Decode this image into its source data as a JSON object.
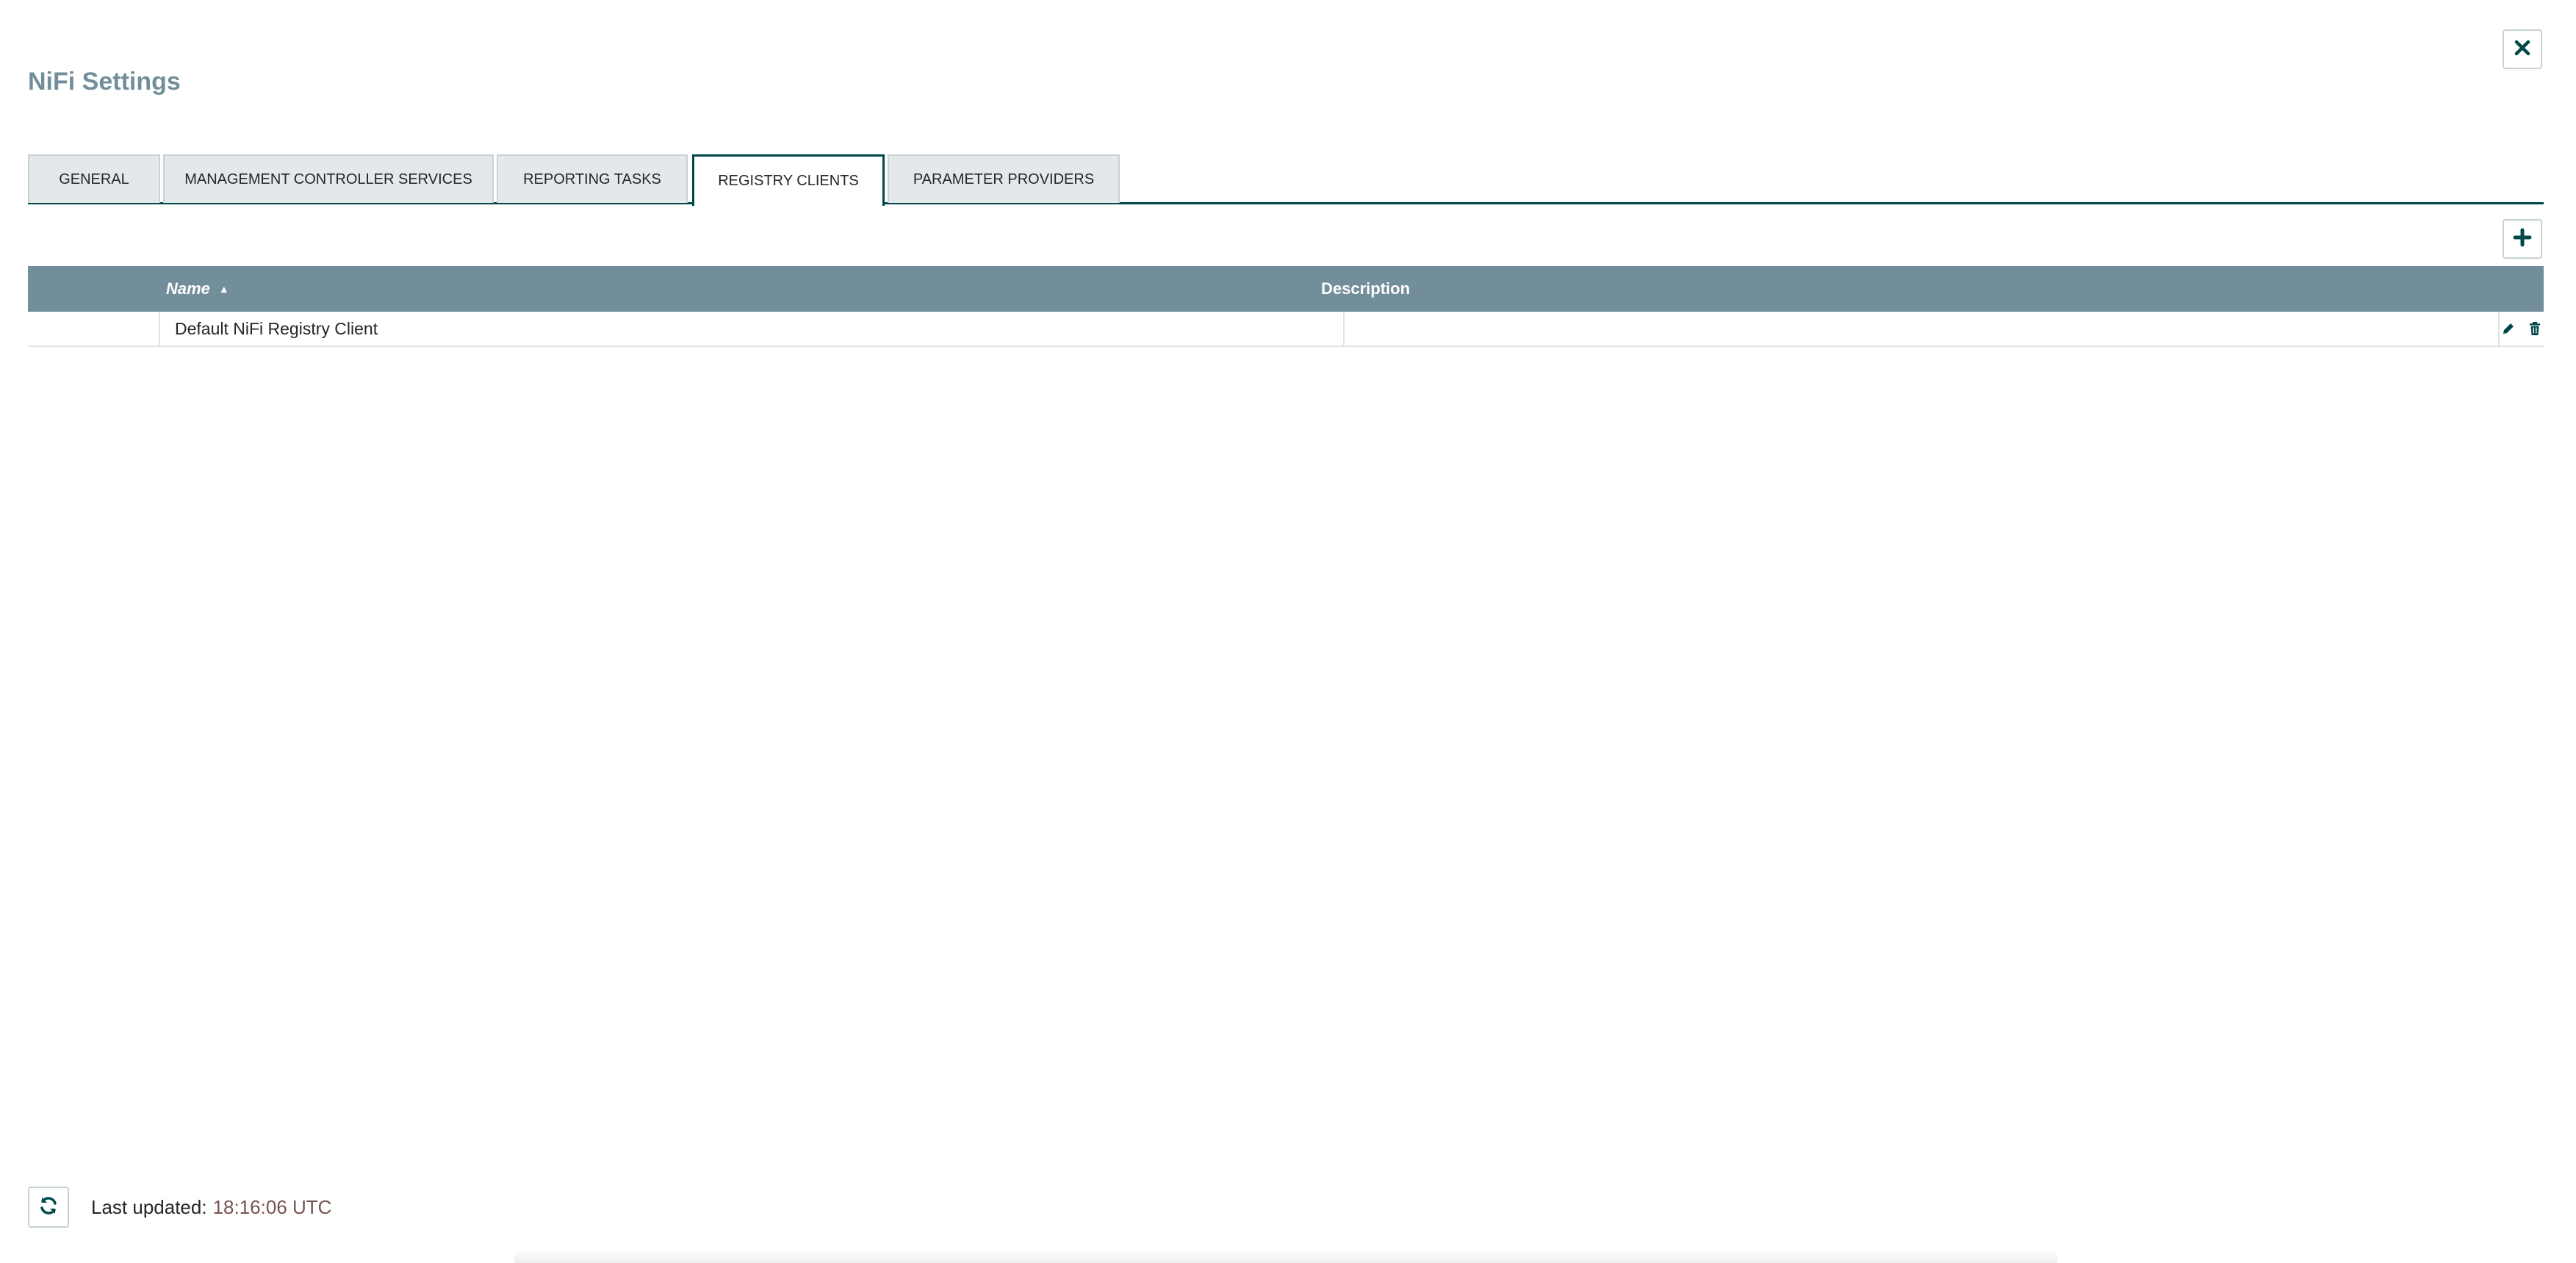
{
  "dialog": {
    "title": "NiFi Settings"
  },
  "tabs": [
    {
      "label": "General",
      "active": false
    },
    {
      "label": "Management Controller Services",
      "active": false
    },
    {
      "label": "Reporting Tasks",
      "active": false
    },
    {
      "label": "Registry Clients",
      "active": true
    },
    {
      "label": "Parameter Providers",
      "active": false
    }
  ],
  "table": {
    "columns": {
      "name": "Name",
      "description": "Description"
    },
    "sort": {
      "column": "name",
      "direction": "ascending"
    },
    "rows": [
      {
        "name": "Default NiFi Registry Client",
        "description": ""
      }
    ]
  },
  "footer": {
    "last_updated_label": "Last updated:",
    "last_updated_value": "18:16:06 UTC"
  },
  "icons": {
    "close": "close-icon",
    "add": "plus-icon",
    "edit": "pencil-icon",
    "delete": "trash-icon",
    "refresh": "refresh-icon"
  },
  "colors": {
    "accent": "#004849",
    "header_bg": "#728e9b",
    "title": "#728e9b",
    "timestamp": "#775351",
    "tab_bg": "#e3e8eb"
  }
}
